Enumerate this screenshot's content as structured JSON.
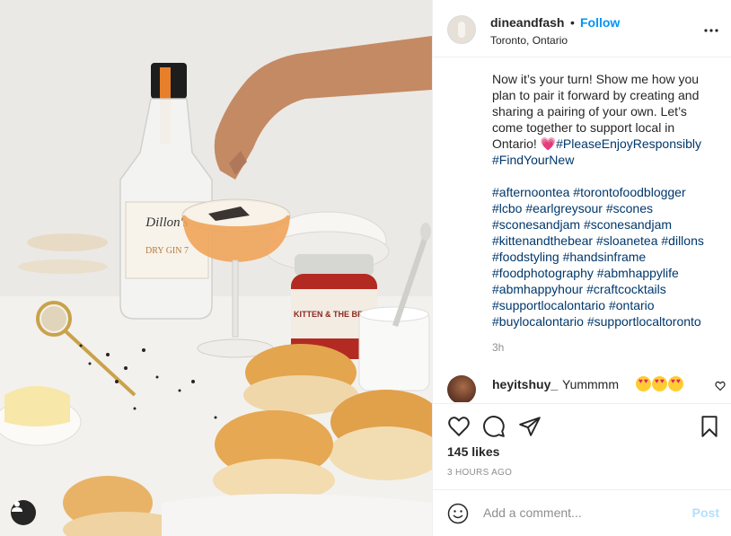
{
  "post": {
    "username": "dineandfash",
    "dot": "•",
    "follow_label": "Follow",
    "location": "Toronto, Ontario"
  },
  "caption": {
    "lines_text": "Now it’s your turn! Show me how you plan to pair it forward by creating and sharing a pairing of your own. Let’s come together to support local in Ontario! ",
    "heart_emoji": "💗",
    "inline_tags": [
      "#PleaseEnjoyResponsibly",
      "#FindYourNew"
    ],
    "hashtags": [
      "#afternoontea",
      "#torontofoodblogger",
      "#lcbo",
      "#earlgreysour",
      "#scones",
      "#sconesandjam",
      "#sconesandjam",
      "#kittenandthebear",
      "#sloanetea",
      "#dillons",
      "#foodstyling",
      "#handsinframe",
      "#foodphotography",
      "#abmhappylife",
      "#abmhappyhour",
      "#craftcocktails",
      "#supportlocalontario",
      "#ontario",
      "#buylocalontario",
      "#supportlocaltoronto"
    ],
    "time": "3h"
  },
  "comment": {
    "username": "heyitshuy_",
    "text": "Yummmm"
  },
  "actions": {
    "likes": "145 likes",
    "time_ago": "3 HOURS AGO"
  },
  "add_comment": {
    "placeholder": "Add a comment...",
    "post_label": "Post"
  },
  "photo": {
    "bottle_label_brand": "Dillon's",
    "bottle_label_product": "DRY GIN 7",
    "jar_label": "KITTEN & THE BEAR"
  },
  "colors": {
    "link_blue": "#0095f6",
    "hashtag_navy": "#00376b",
    "muted": "#8e8e8e",
    "post_disabled": "#b2dffc"
  },
  "icons": [
    "more-icon",
    "heart-icon",
    "comment-icon",
    "share-icon",
    "bookmark-icon",
    "emoji-icon",
    "user-tag-icon"
  ]
}
